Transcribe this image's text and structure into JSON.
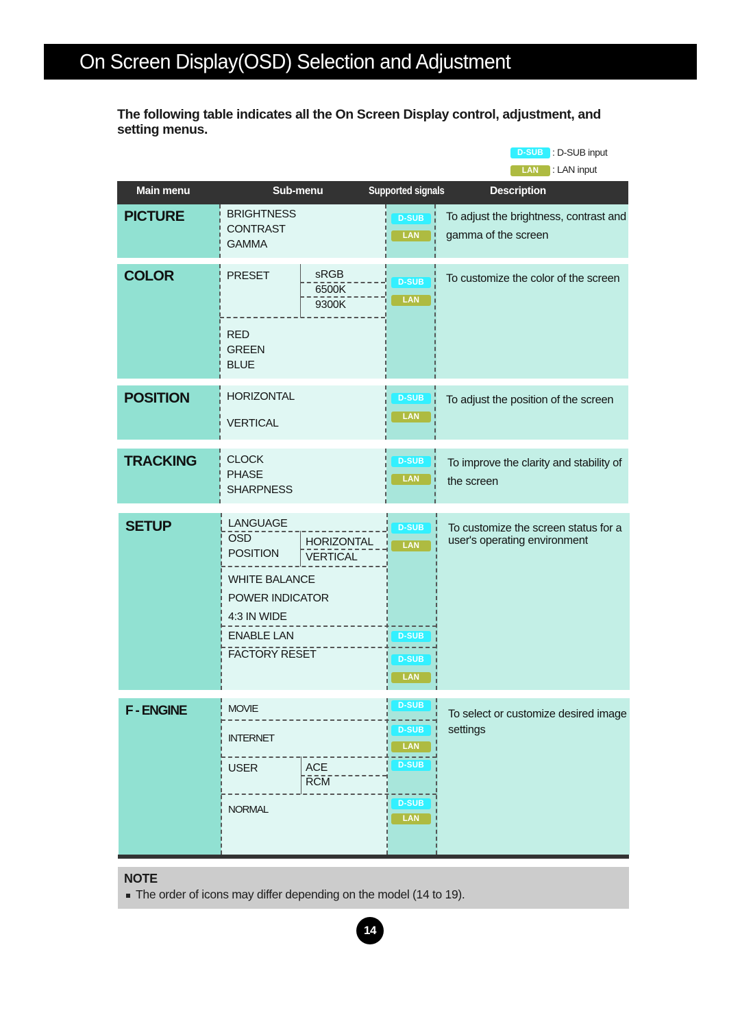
{
  "header": {
    "title": "On Screen Display(OSD) Selection and Adjustment"
  },
  "intro": "The following table indicates all the On Screen Display control, adjustment, and setting menus.",
  "legend": {
    "dsub_badge": "D-SUB",
    "dsub_text": ": D-SUB input",
    "lan_badge": "LAN",
    "lan_text": ": LAN input"
  },
  "badges": {
    "dsub": "D-SUB",
    "lan": "LAN"
  },
  "colors": {
    "dsub": "#33f0ff",
    "lan": "#aebb41",
    "main_col": "#91e1d2",
    "sub_col": "#e0f7f3",
    "signal_col": "#a8e6db",
    "desc_col": "#c3efe6",
    "header_bg": "#333333"
  },
  "table": {
    "headers": {
      "main": "Main menu",
      "sub": "Sub-menu",
      "signals": "Supported signals",
      "description": "Description"
    },
    "sections": {
      "picture": {
        "main": "PICTURE",
        "sub": [
          "BRIGHTNESS",
          "CONTRAST",
          "GAMMA"
        ],
        "signals": [
          "D-SUB",
          "LAN"
        ],
        "description": "To adjust the brightness, contrast and gamma of the screen"
      },
      "color": {
        "main": "COLOR",
        "preset_label": "PRESET",
        "preset_options": [
          "sRGB",
          "6500K",
          "9300K"
        ],
        "sub": [
          "RED",
          "GREEN",
          "BLUE"
        ],
        "signals": [
          "D-SUB",
          "LAN"
        ],
        "description": "To customize the color of the screen"
      },
      "position": {
        "main": "POSITION",
        "sub": [
          "HORIZONTAL",
          "VERTICAL"
        ],
        "signals": [
          "D-SUB",
          "LAN"
        ],
        "description": "To adjust the position of the screen"
      },
      "tracking": {
        "main": "TRACKING",
        "sub": [
          "CLOCK",
          "PHASE",
          "SHARPNESS"
        ],
        "signals": [
          "D-SUB",
          "LAN"
        ],
        "description": "To improve the clarity and stability of the screen"
      },
      "setup": {
        "main": "SETUP",
        "language": "LANGUAGE",
        "osd_position": [
          "OSD",
          "POSITION"
        ],
        "osd_options": [
          "HORIZONTAL",
          "VERTICAL"
        ],
        "sub": [
          "WHITE BALANCE",
          "POWER INDICATOR",
          "4:3 IN WIDE"
        ],
        "enable_lan": "ENABLE LAN",
        "factory_reset": "FACTORY RESET",
        "signals": [
          "D-SUB",
          "LAN"
        ],
        "enable_lan_signals": [
          "D-SUB"
        ],
        "factory_reset_signals": [
          "D-SUB",
          "LAN"
        ],
        "description": "To customize the screen status for a user's operating environment"
      },
      "fengine": {
        "main": "F - ENGINE",
        "movie": "MOVIE",
        "movie_signals": [
          "D-SUB"
        ],
        "internet": "INTERNET",
        "internet_signals": [
          "D-SUB",
          "LAN"
        ],
        "user": "USER",
        "user_options": [
          "ACE",
          "RCM"
        ],
        "user_signals": [
          "D-SUB"
        ],
        "normal": "NORMAL",
        "normal_signals": [
          "D-SUB",
          "LAN"
        ],
        "description": "To select or customize desired image settings"
      }
    }
  },
  "note": {
    "title": "NOTE",
    "text": "The order of icons may differ depending on the model (14 to 19)."
  },
  "page_number": "14"
}
